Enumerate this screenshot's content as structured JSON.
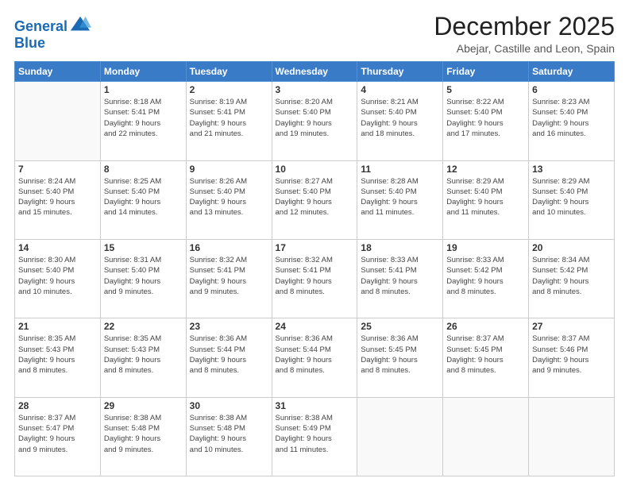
{
  "header": {
    "logo_line1": "General",
    "logo_line2": "Blue",
    "month": "December 2025",
    "location": "Abejar, Castille and Leon, Spain"
  },
  "weekdays": [
    "Sunday",
    "Monday",
    "Tuesday",
    "Wednesday",
    "Thursday",
    "Friday",
    "Saturday"
  ],
  "weeks": [
    [
      {
        "day": "",
        "sunrise": "",
        "sunset": "",
        "daylight": ""
      },
      {
        "day": "1",
        "sunrise": "Sunrise: 8:18 AM",
        "sunset": "Sunset: 5:41 PM",
        "daylight": "Daylight: 9 hours and 22 minutes."
      },
      {
        "day": "2",
        "sunrise": "Sunrise: 8:19 AM",
        "sunset": "Sunset: 5:41 PM",
        "daylight": "Daylight: 9 hours and 21 minutes."
      },
      {
        "day": "3",
        "sunrise": "Sunrise: 8:20 AM",
        "sunset": "Sunset: 5:40 PM",
        "daylight": "Daylight: 9 hours and 19 minutes."
      },
      {
        "day": "4",
        "sunrise": "Sunrise: 8:21 AM",
        "sunset": "Sunset: 5:40 PM",
        "daylight": "Daylight: 9 hours and 18 minutes."
      },
      {
        "day": "5",
        "sunrise": "Sunrise: 8:22 AM",
        "sunset": "Sunset: 5:40 PM",
        "daylight": "Daylight: 9 hours and 17 minutes."
      },
      {
        "day": "6",
        "sunrise": "Sunrise: 8:23 AM",
        "sunset": "Sunset: 5:40 PM",
        "daylight": "Daylight: 9 hours and 16 minutes."
      }
    ],
    [
      {
        "day": "7",
        "sunrise": "Sunrise: 8:24 AM",
        "sunset": "Sunset: 5:40 PM",
        "daylight": "Daylight: 9 hours and 15 minutes."
      },
      {
        "day": "8",
        "sunrise": "Sunrise: 8:25 AM",
        "sunset": "Sunset: 5:40 PM",
        "daylight": "Daylight: 9 hours and 14 minutes."
      },
      {
        "day": "9",
        "sunrise": "Sunrise: 8:26 AM",
        "sunset": "Sunset: 5:40 PM",
        "daylight": "Daylight: 9 hours and 13 minutes."
      },
      {
        "day": "10",
        "sunrise": "Sunrise: 8:27 AM",
        "sunset": "Sunset: 5:40 PM",
        "daylight": "Daylight: 9 hours and 12 minutes."
      },
      {
        "day": "11",
        "sunrise": "Sunrise: 8:28 AM",
        "sunset": "Sunset: 5:40 PM",
        "daylight": "Daylight: 9 hours and 11 minutes."
      },
      {
        "day": "12",
        "sunrise": "Sunrise: 8:29 AM",
        "sunset": "Sunset: 5:40 PM",
        "daylight": "Daylight: 9 hours and 11 minutes."
      },
      {
        "day": "13",
        "sunrise": "Sunrise: 8:29 AM",
        "sunset": "Sunset: 5:40 PM",
        "daylight": "Daylight: 9 hours and 10 minutes."
      }
    ],
    [
      {
        "day": "14",
        "sunrise": "Sunrise: 8:30 AM",
        "sunset": "Sunset: 5:40 PM",
        "daylight": "Daylight: 9 hours and 10 minutes."
      },
      {
        "day": "15",
        "sunrise": "Sunrise: 8:31 AM",
        "sunset": "Sunset: 5:40 PM",
        "daylight": "Daylight: 9 hours and 9 minutes."
      },
      {
        "day": "16",
        "sunrise": "Sunrise: 8:32 AM",
        "sunset": "Sunset: 5:41 PM",
        "daylight": "Daylight: 9 hours and 9 minutes."
      },
      {
        "day": "17",
        "sunrise": "Sunrise: 8:32 AM",
        "sunset": "Sunset: 5:41 PM",
        "daylight": "Daylight: 9 hours and 8 minutes."
      },
      {
        "day": "18",
        "sunrise": "Sunrise: 8:33 AM",
        "sunset": "Sunset: 5:41 PM",
        "daylight": "Daylight: 9 hours and 8 minutes."
      },
      {
        "day": "19",
        "sunrise": "Sunrise: 8:33 AM",
        "sunset": "Sunset: 5:42 PM",
        "daylight": "Daylight: 9 hours and 8 minutes."
      },
      {
        "day": "20",
        "sunrise": "Sunrise: 8:34 AM",
        "sunset": "Sunset: 5:42 PM",
        "daylight": "Daylight: 9 hours and 8 minutes."
      }
    ],
    [
      {
        "day": "21",
        "sunrise": "Sunrise: 8:35 AM",
        "sunset": "Sunset: 5:43 PM",
        "daylight": "Daylight: 9 hours and 8 minutes."
      },
      {
        "day": "22",
        "sunrise": "Sunrise: 8:35 AM",
        "sunset": "Sunset: 5:43 PM",
        "daylight": "Daylight: 9 hours and 8 minutes."
      },
      {
        "day": "23",
        "sunrise": "Sunrise: 8:36 AM",
        "sunset": "Sunset: 5:44 PM",
        "daylight": "Daylight: 9 hours and 8 minutes."
      },
      {
        "day": "24",
        "sunrise": "Sunrise: 8:36 AM",
        "sunset": "Sunset: 5:44 PM",
        "daylight": "Daylight: 9 hours and 8 minutes."
      },
      {
        "day": "25",
        "sunrise": "Sunrise: 8:36 AM",
        "sunset": "Sunset: 5:45 PM",
        "daylight": "Daylight: 9 hours and 8 minutes."
      },
      {
        "day": "26",
        "sunrise": "Sunrise: 8:37 AM",
        "sunset": "Sunset: 5:45 PM",
        "daylight": "Daylight: 9 hours and 8 minutes."
      },
      {
        "day": "27",
        "sunrise": "Sunrise: 8:37 AM",
        "sunset": "Sunset: 5:46 PM",
        "daylight": "Daylight: 9 hours and 9 minutes."
      }
    ],
    [
      {
        "day": "28",
        "sunrise": "Sunrise: 8:37 AM",
        "sunset": "Sunset: 5:47 PM",
        "daylight": "Daylight: 9 hours and 9 minutes."
      },
      {
        "day": "29",
        "sunrise": "Sunrise: 8:38 AM",
        "sunset": "Sunset: 5:48 PM",
        "daylight": "Daylight: 9 hours and 9 minutes."
      },
      {
        "day": "30",
        "sunrise": "Sunrise: 8:38 AM",
        "sunset": "Sunset: 5:48 PM",
        "daylight": "Daylight: 9 hours and 10 minutes."
      },
      {
        "day": "31",
        "sunrise": "Sunrise: 8:38 AM",
        "sunset": "Sunset: 5:49 PM",
        "daylight": "Daylight: 9 hours and 11 minutes."
      },
      {
        "day": "",
        "sunrise": "",
        "sunset": "",
        "daylight": ""
      },
      {
        "day": "",
        "sunrise": "",
        "sunset": "",
        "daylight": ""
      },
      {
        "day": "",
        "sunrise": "",
        "sunset": "",
        "daylight": ""
      }
    ]
  ]
}
